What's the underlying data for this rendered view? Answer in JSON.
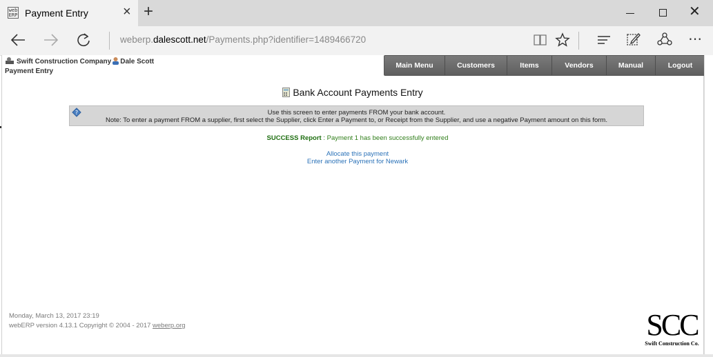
{
  "browser": {
    "tab_title": "Payment Entry",
    "favicon_text": "web ERP",
    "new_tab_symbol": "+",
    "close_tab_symbol": "×",
    "url_prefix": "weberp.",
    "url_host": "dalescott.net",
    "url_path": "/Payments.php?identifier=1489466720",
    "icons": [
      "back-arrow-icon",
      "forward-arrow-icon",
      "refresh-icon",
      "reading-view-icon",
      "favorite-star-icon",
      "hub-icon",
      "web-note-icon",
      "share-icon",
      "more-icon"
    ]
  },
  "header": {
    "company": "Swift Construction Company",
    "user": "Dale Scott",
    "page_name": "Payment Entry"
  },
  "menu": [
    "Main Menu",
    "Customers",
    "Items",
    "Vendors",
    "Manual",
    "Logout"
  ],
  "main": {
    "title": "Bank Account Payments Entry",
    "info_line1": "Use this screen to enter payments FROM your bank account.",
    "info_line2": "Note: To enter a payment FROM a supplier, first select the Supplier, click Enter a Payment to, or Receipt from the Supplier, and use a negative Payment amount on this form.",
    "success_label": "SUCCESS Report",
    "success_text": " : Payment 1 has been successfully entered",
    "link_allocate": "Allocate this payment",
    "link_another": "Enter another Payment for Newark"
  },
  "footer": {
    "datetime": "Monday, March 13, 2017 23:19",
    "version": "webERP version 4.13.1 Copyright © 2004 - 2017 ",
    "site_link": "weberp.org",
    "logo_big": "SCC",
    "logo_small": "Swift Construction Co."
  },
  "colors": {
    "success": "#2e7d18",
    "link": "#2b72b8",
    "menu_bg": "#6b6b6b"
  }
}
